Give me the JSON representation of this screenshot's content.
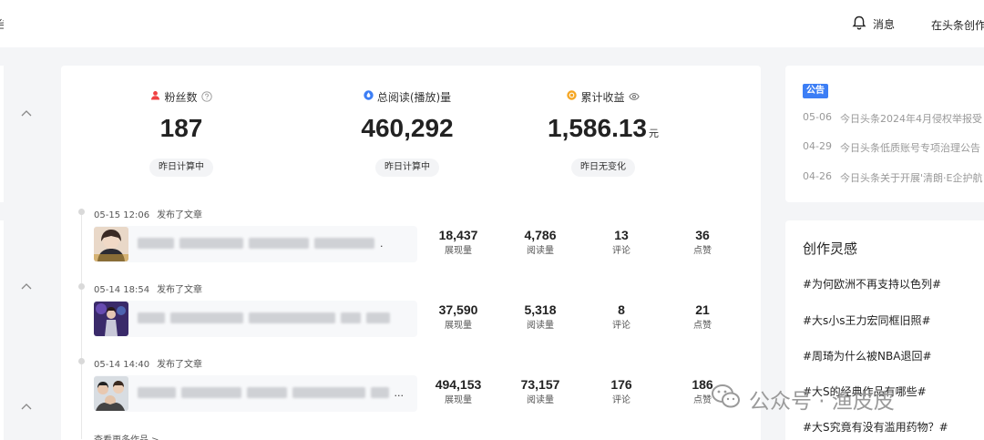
{
  "topbar": {
    "logo_fragment": "台",
    "messages_label": "消息",
    "creator_link": "在头条创作"
  },
  "stats": [
    {
      "label": "粉丝数",
      "value": "187",
      "unit": "",
      "note": "昨日计算中",
      "icon": "person-icon",
      "color": "#f04142"
    },
    {
      "label": "总阅读(播放)量",
      "value": "460,292",
      "unit": "",
      "note": "昨日计算中",
      "icon": "drop-icon",
      "color": "#3c7ef5"
    },
    {
      "label": "累计收益",
      "value": "1,586.13",
      "unit": "元",
      "note": "昨日无变化",
      "icon": "coin-icon",
      "color": "#f5a623"
    }
  ],
  "articles": [
    {
      "time": "05-15 12:06",
      "action": "发布了文章",
      "thumb": "portrait-thumbnail",
      "metrics": [
        {
          "value": "18,437",
          "label": "展现量"
        },
        {
          "value": "4,786",
          "label": "阅读量"
        },
        {
          "value": "13",
          "label": "评论"
        },
        {
          "value": "36",
          "label": "点赞"
        }
      ]
    },
    {
      "time": "05-14 18:54",
      "action": "发布了文章",
      "thumb": "stage-photo-thumbnail",
      "metrics": [
        {
          "value": "37,590",
          "label": "展现量"
        },
        {
          "value": "5,318",
          "label": "阅读量"
        },
        {
          "value": "8",
          "label": "评论"
        },
        {
          "value": "21",
          "label": "点赞"
        }
      ]
    },
    {
      "time": "05-14 14:40",
      "action": "发布了文章",
      "thumb": "group-photo-thumbnail",
      "metrics": [
        {
          "value": "494,153",
          "label": "展现量"
        },
        {
          "value": "73,157",
          "label": "阅读量"
        },
        {
          "value": "176",
          "label": "评论"
        },
        {
          "value": "186",
          "label": "点赞"
        }
      ]
    }
  ],
  "more_link": "查看更多作品 >",
  "notice": {
    "badge": "公告",
    "items": [
      {
        "date": "05-06",
        "title": "今日头条2024年4月侵权举报受"
      },
      {
        "date": "04-29",
        "title": "今日头条低质账号专项治理公告"
      },
      {
        "date": "04-26",
        "title": "今日头条关于开展'清朗·E企护航"
      }
    ]
  },
  "inspiration": {
    "title": "创作灵感",
    "topics": [
      "#为何欧洲不再支持以色列#",
      "#大s小s王力宏同框旧照#",
      "#周琦为什么被NBA退回#",
      "#大S的经典作品有哪些#",
      "#大S究竟有没有滥用药物？#"
    ]
  },
  "watermark": {
    "text": "公众号 · 渔皮皮",
    "icon": "wechat-icon"
  },
  "colors": {
    "accent": "#3c7ef5",
    "background": "#f4f5f7"
  }
}
